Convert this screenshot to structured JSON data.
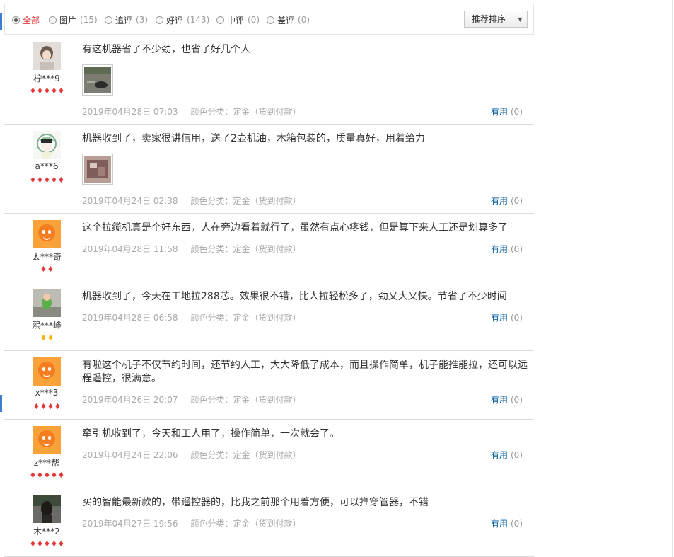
{
  "filter": {
    "options": [
      {
        "label": "全部",
        "count": "",
        "selected": true
      },
      {
        "label": "图片",
        "count": "(15)",
        "selected": false
      },
      {
        "label": "追评",
        "count": "(3)",
        "selected": false
      },
      {
        "label": "好评",
        "count": "(143)",
        "selected": false
      },
      {
        "label": "中评",
        "count": "(0)",
        "selected": false
      },
      {
        "label": "差评",
        "count": "(0)",
        "selected": false
      }
    ],
    "sort_label": "推荐排序"
  },
  "useful_label": "有用",
  "reviews": [
    {
      "user": "柠***9",
      "rating": 5,
      "text": "有这机器省了不少劲，也省了好几个人",
      "date": "2019年04月28日 07:03",
      "color_class": "颜色分类：定金（货到付款）",
      "useful_count": "(0)"
    },
    {
      "user": "a***6",
      "rating": 5,
      "text": "机器收到了，卖家很讲信用，送了2壶机油，木箱包装的，质量真好，用着给力",
      "date": "2019年04月24日 02:38",
      "color_class": "颜色分类：定金（货到付款）",
      "useful_count": "(0)"
    },
    {
      "user": "太***奇",
      "rating": 2,
      "text": "这个拉缆机真是个好东西，人在旁边看着就行了，虽然有点心疼钱，但是算下来人工还是划算多了",
      "date": "2019年04月28日 11:58",
      "color_class": "颜色分类：定金（货到付款）",
      "useful_count": "(0)"
    },
    {
      "user": "熙***峰",
      "rating": 2,
      "text": "机器收到了，今天在工地拉288芯。效果很不错，比人拉轻松多了，劲又大又快。节省了不少时间",
      "date": "2019年04月28日 06:58",
      "color_class": "颜色分类：定金（货到付款）",
      "useful_count": "(0)"
    },
    {
      "user": "x***3",
      "rating": 4,
      "text": "有啦这个机子不仅节约时间，还节约人工，大大降低了成本，而且操作简单，机子能推能拉，还可以远程遥控，很满意。",
      "date": "2019年04月26日 20:07",
      "color_class": "颜色分类：定金（货到付款）",
      "useful_count": "(0)"
    },
    {
      "user": "z***帮",
      "rating": 5,
      "text": "牵引机收到了，今天和工人用了，操作简单，一次就会了。",
      "date": "2019年04月24日 22:06",
      "color_class": "颜色分类：定金（货到付款）",
      "useful_count": "(0)"
    },
    {
      "user": "木***2",
      "rating": 5,
      "text": "买的智能最新款的，带遥控器的，比我之前那个用着方便，可以推穿管器，不错",
      "date": "2019年04月27日 19:56",
      "color_class": "颜色分类：定金（货到付款）",
      "useful_count": "(0)"
    }
  ]
}
